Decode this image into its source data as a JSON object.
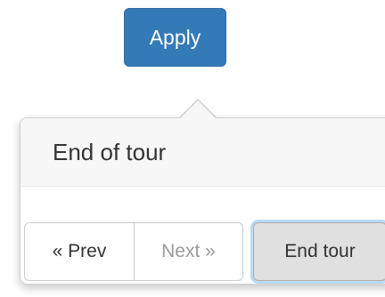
{
  "apply_button": {
    "label": "Apply",
    "color": "#337ab7"
  },
  "tour_popover": {
    "title": "End of tour",
    "prev_label": "« Prev",
    "next_label": "Next »",
    "end_label": "End tour"
  }
}
